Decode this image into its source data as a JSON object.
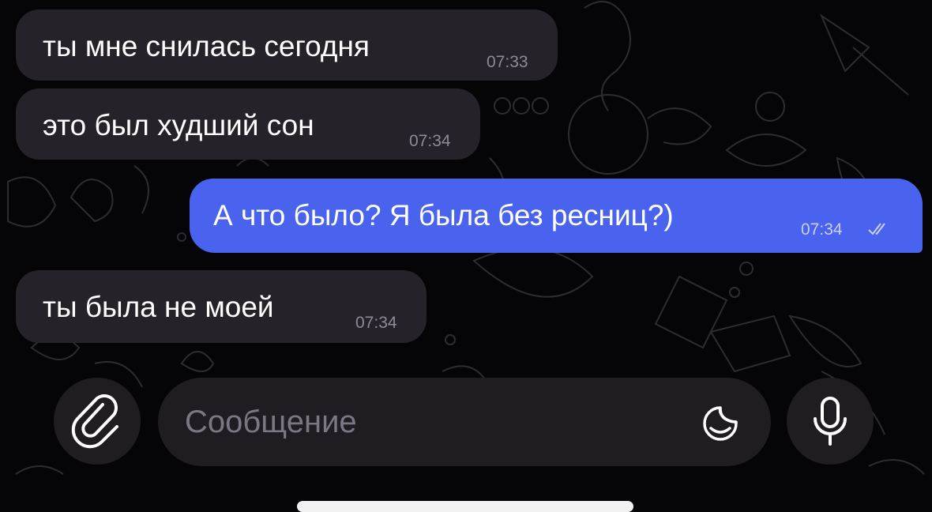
{
  "chat": {
    "messages": [
      {
        "direction": "incoming",
        "text": "ты мне снилась сегодня",
        "time": "07:33"
      },
      {
        "direction": "incoming",
        "text": "это был худший сон",
        "time": "07:34"
      },
      {
        "direction": "outgoing",
        "text": "А что было? Я была без ресниц?)",
        "time": "07:34",
        "status": "read"
      },
      {
        "direction": "incoming",
        "text": "ты была не моей",
        "time": "07:34"
      }
    ]
  },
  "composer": {
    "placeholder": "Сообщение",
    "attach_icon": "paperclip-icon",
    "sticker_icon": "sticker-icon",
    "mic_icon": "microphone-icon"
  },
  "colors": {
    "background": "#050507",
    "incoming_bubble": "#252229",
    "outgoing_bubble": "#4a63ee",
    "composer": "#1f1c22"
  }
}
